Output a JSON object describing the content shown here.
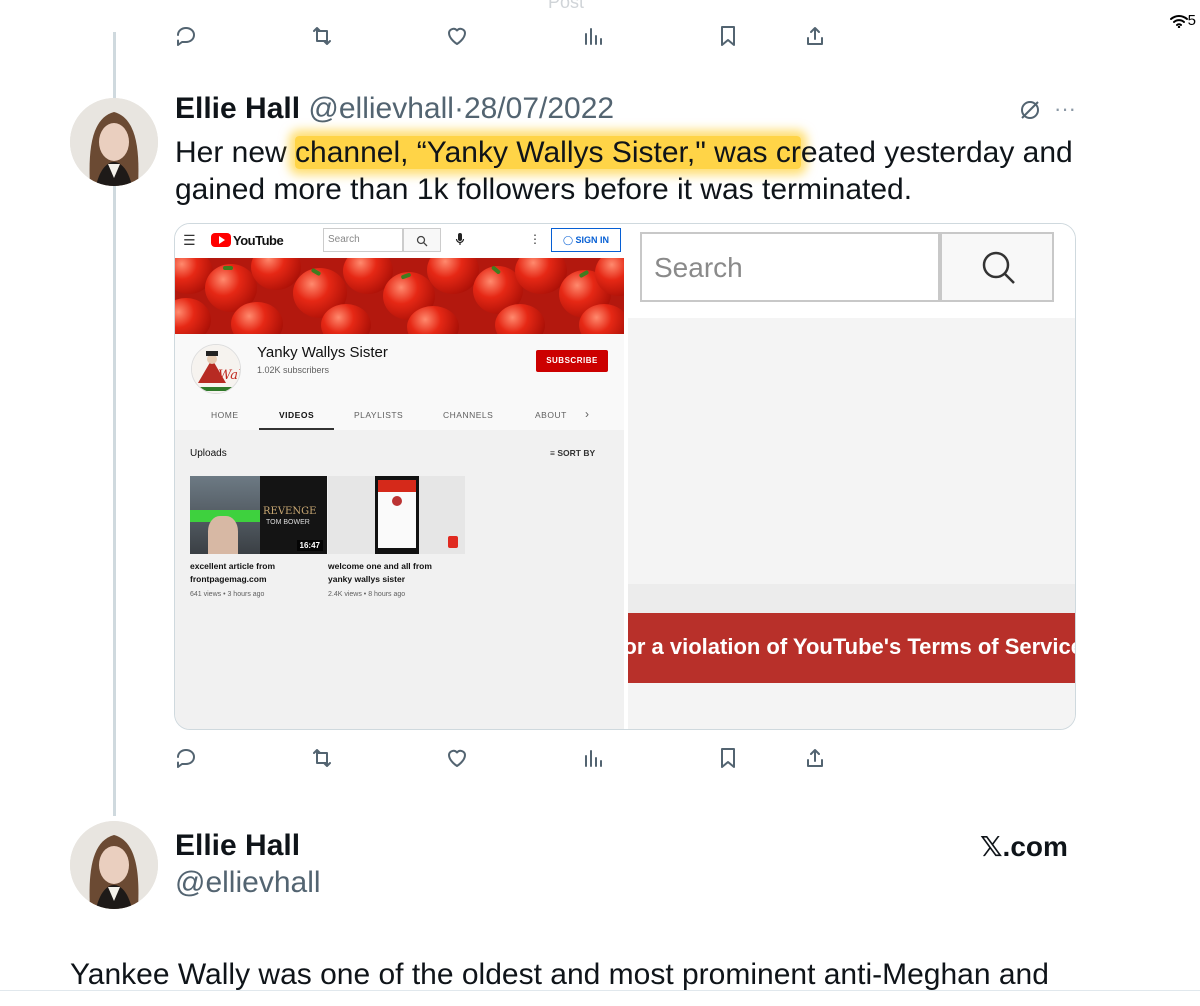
{
  "status_bar": {
    "wifi_icon": "wifi-icon",
    "battery_partial": "5"
  },
  "faded_top": "Post",
  "tweet": {
    "author_name": "Ellie Hall",
    "author_handle": "@ellievhall",
    "separator": "·",
    "date": "28/07/2022",
    "text_before": "Her new ",
    "text_highlight": "channel, “Yanky Wallys Sister,\" was cr",
    "text_after": "eated yesterday and gained more than 1k followers before it was terminated.",
    "highlight_color": "#ffc400",
    "grok_icon": "grok-icon",
    "more_icon": "···"
  },
  "youtube": {
    "logo_text": "YouTube",
    "search_placeholder": "Search",
    "sign_in": "SIGN IN",
    "channel_name": "Yanky Wallys Sister",
    "subscribers": "1.02K subscribers",
    "subscribe": "SUBSCRIBE",
    "tabs": [
      "HOME",
      "VIDEOS",
      "PLAYLISTS",
      "CHANNELS",
      "ABOUT"
    ],
    "active_tab": "VIDEOS",
    "uploads_label": "Uploads",
    "sort_by": "SORT BY",
    "videos": [
      {
        "title": "excellent article from frontpagemag.com",
        "meta": "641 views • 3 hours ago",
        "duration": "16:47",
        "thumb_text_1": "REVENGE",
        "thumb_text_2": "TOM BOWER"
      },
      {
        "title": "welcome one and all from yanky wallys sister",
        "meta": "2.4K views • 8 hours ago"
      }
    ],
    "avatar_text": "Wales",
    "terminated_search": "Search",
    "terminated_banner": "or a violation of YouTube's Terms of Service",
    "brand_red": "#cc0000"
  },
  "actions": {
    "reply": "reply-icon",
    "repost": "repost-icon",
    "like": "like-icon",
    "views": "views-icon",
    "bookmark": "bookmark-icon",
    "share": "share-icon"
  },
  "quote_card": {
    "author_name": "Ellie Hall",
    "author_handle": "@ellievhall",
    "source": "𝕏.com"
  },
  "bottom_text": "Yankee Wally was one of the oldest and most prominent anti-Meghan and"
}
